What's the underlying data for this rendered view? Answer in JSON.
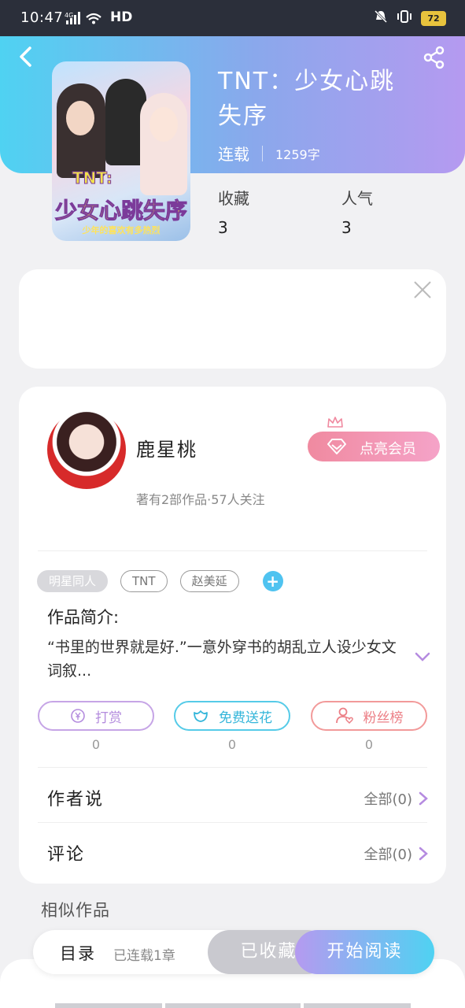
{
  "status_bar": {
    "time": "10:47",
    "network": "4G",
    "hd": "HD",
    "battery": "72"
  },
  "book": {
    "title": "TNT：少女心跳失序",
    "status": "连载",
    "word_count": "1259字",
    "stats": [
      {
        "label": "收藏",
        "value": "3"
      },
      {
        "label": "人气",
        "value": "3"
      }
    ],
    "cover_text": {
      "line1": "TNT:",
      "line2": "少女心跳失序",
      "line3": "少年的喜欢有多热烈"
    }
  },
  "author": {
    "name": "鹿星桃",
    "info": "著有2部作品·57人关注",
    "vip_button": "点亮会员"
  },
  "tags": [
    "明星同人",
    "TNT",
    "赵美延"
  ],
  "intro": {
    "label": "作品简介:",
    "text": "“书里的世界就是好.”一意外穿书的胡乱立人设少女文词叙..."
  },
  "actions": [
    {
      "label": "打赏",
      "count": "0"
    },
    {
      "label": "免费送花",
      "count": "0"
    },
    {
      "label": "粉丝榜",
      "count": "0"
    }
  ],
  "rows": {
    "author_says": {
      "label": "作者说",
      "more": "全部(0)"
    },
    "comments": {
      "label": "评论",
      "more": "全部(0)"
    }
  },
  "similar_label": "相似作品",
  "bottom_bar": {
    "catalog": "目录",
    "progress": "已连载1章",
    "collected": "已收藏",
    "read": "开始阅读"
  },
  "colors": {
    "header_start": "#4fd2f2",
    "header_end": "#b59af0",
    "vip_pink": "#f08aa0",
    "accent_blue": "#4fc3f0"
  }
}
